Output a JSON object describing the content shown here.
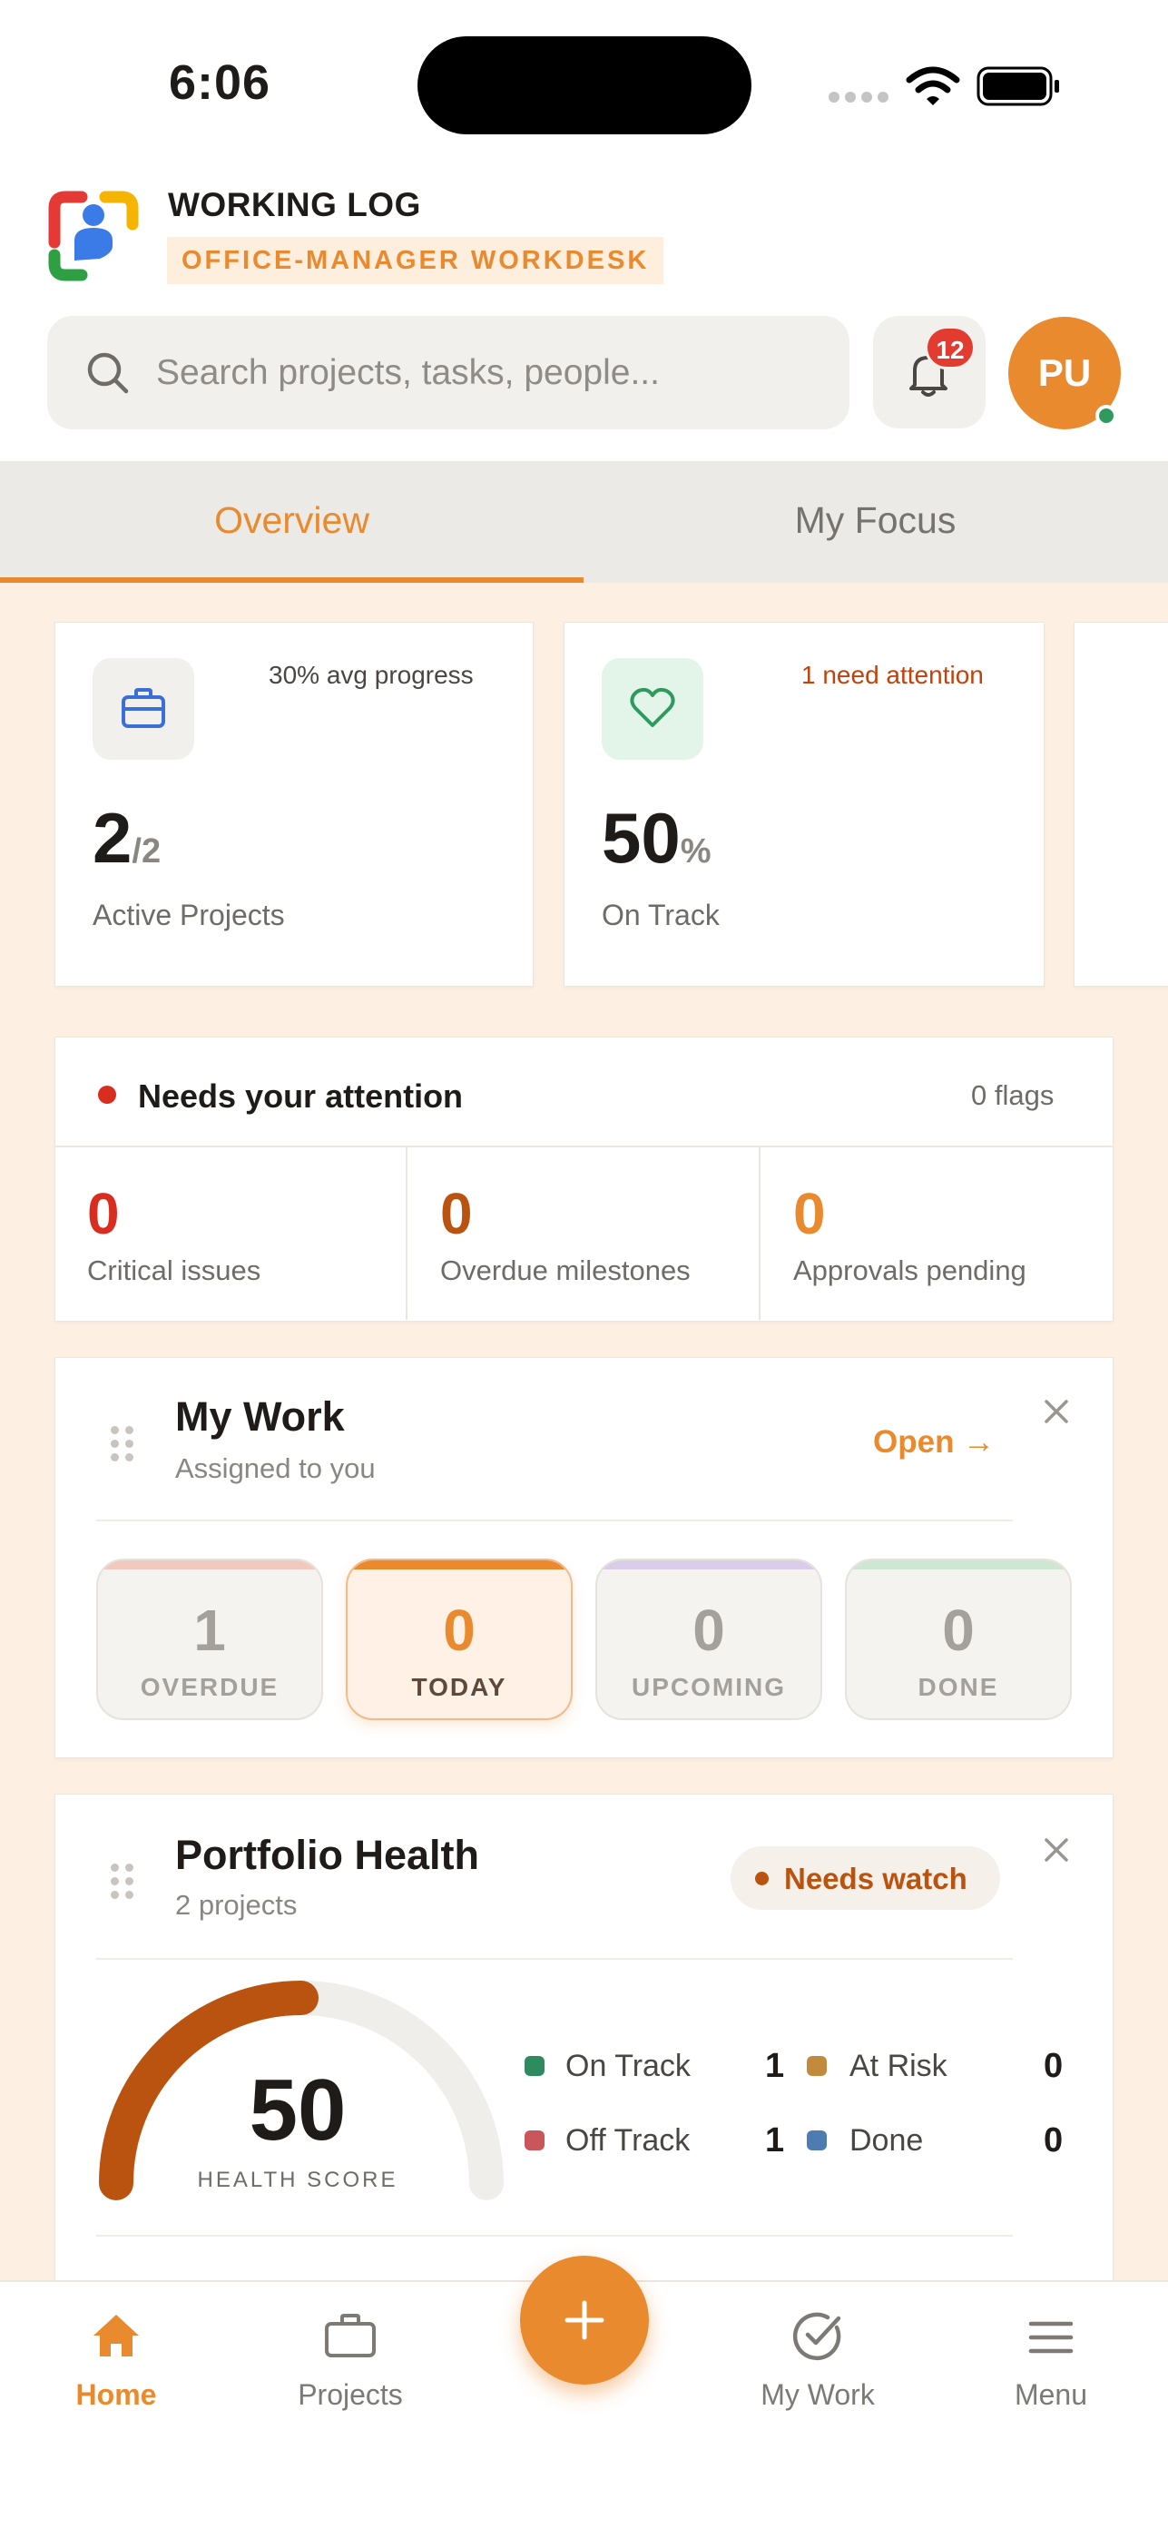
{
  "status_bar": {
    "time": "6:06"
  },
  "header": {
    "app_title": "WORKING LOG",
    "app_subtitle": "OFFICE-MANAGER WORKDESK",
    "search_placeholder": "Search projects, tasks, people...",
    "notification_count": "12",
    "avatar_initials": "PU"
  },
  "tabs": [
    {
      "label": "Overview",
      "active": true
    },
    {
      "label": "My Focus",
      "active": false
    }
  ],
  "stats": [
    {
      "top": "30% avg progress",
      "value": "2",
      "suffix": "/2",
      "label": "Active Projects",
      "icon": "briefcase-icon"
    },
    {
      "top": "1 need attention",
      "value": "50",
      "suffix": "%",
      "label": "On Track",
      "icon": "heart-icon"
    }
  ],
  "attention": {
    "title": "Needs your attention",
    "flags": "0 flags",
    "items": [
      {
        "value": "0",
        "label": "Critical issues",
        "color": "#d92d20"
      },
      {
        "value": "0",
        "label": "Overdue milestones",
        "color": "#b9530f"
      },
      {
        "value": "0",
        "label": "Approvals pending",
        "color": "#ea8a2e"
      }
    ]
  },
  "my_work": {
    "title": "My Work",
    "subtitle": "Assigned to you",
    "open_label": "Open →",
    "pills": [
      {
        "value": "1",
        "label": "OVERDUE",
        "bar": "#f2c9bf"
      },
      {
        "value": "0",
        "label": "TODAY",
        "bar": "#ea8a2e"
      },
      {
        "value": "0",
        "label": "UPCOMING",
        "bar": "#d9cde9"
      },
      {
        "value": "0",
        "label": "DONE",
        "bar": "#cfe6d3"
      }
    ]
  },
  "portfolio": {
    "title": "Portfolio Health",
    "subtitle": "2 projects",
    "status": "Needs watch",
    "score": 50,
    "score_text": "50",
    "score_label": "HEALTH SCORE",
    "legend": [
      {
        "label": "On Track",
        "value": "1",
        "color": "#2e8b5e"
      },
      {
        "label": "At Risk",
        "value": "0",
        "color": "#c28a3c"
      },
      {
        "label": "Off Track",
        "value": "1",
        "color": "#c9565a"
      },
      {
        "label": "Done",
        "value": "0",
        "color": "#4f7bb3"
      }
    ]
  },
  "nav": {
    "home": "Home",
    "projects": "Projects",
    "my_work": "My Work",
    "menu": "Menu"
  },
  "colors": {
    "accent": "#ea8a2e",
    "gauge": "#b9530f"
  }
}
